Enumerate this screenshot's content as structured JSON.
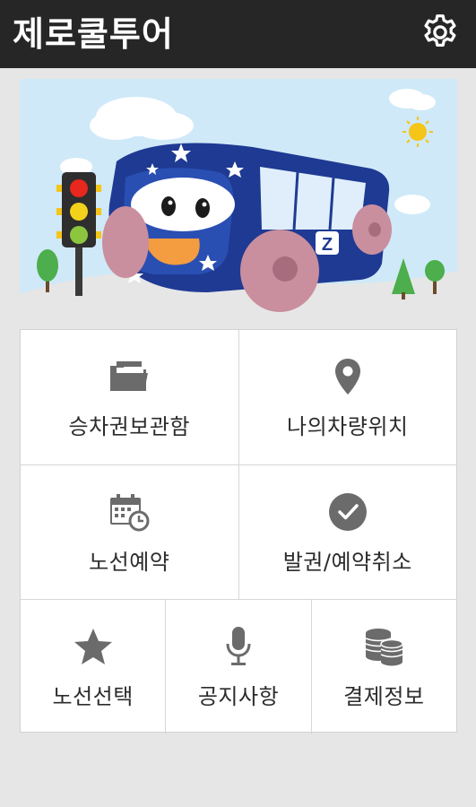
{
  "app": {
    "title": "제로쿨투어"
  },
  "banner": {
    "bus_badge": "Z"
  },
  "menu": {
    "rows": [
      [
        {
          "label": "승차권보관함",
          "icon": "folder-icon"
        },
        {
          "label": "나의차량위치",
          "icon": "location-pin-icon"
        }
      ],
      [
        {
          "label": "노선예약",
          "icon": "calendar-clock-icon"
        },
        {
          "label": "발권/예약취소",
          "icon": "check-circle-icon"
        }
      ],
      [
        {
          "label": "노선선택",
          "icon": "star-icon"
        },
        {
          "label": "공지사항",
          "icon": "microphone-icon"
        },
        {
          "label": "결제정보",
          "icon": "coins-icon"
        }
      ]
    ]
  },
  "colors": {
    "appbar": "#262626",
    "background": "#e6e6e6",
    "icon": "#6b6b6b",
    "sky": "#cfe9f8"
  }
}
